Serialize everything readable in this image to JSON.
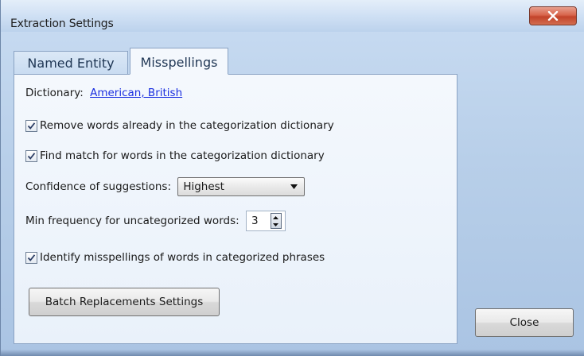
{
  "window": {
    "title": "Extraction Settings"
  },
  "tabs": [
    {
      "label": "Named Entity",
      "active": false
    },
    {
      "label": "Misspellings",
      "active": true
    }
  ],
  "misspellings": {
    "dictionary_label": "Dictionary:",
    "dictionary_value": "American, British",
    "remove_words": {
      "label": "Remove words already in the categorization dictionary",
      "checked": true
    },
    "find_match": {
      "label": "Find match for words in the categorization dictionary",
      "checked": true
    },
    "confidence": {
      "label": "Confidence of suggestions:",
      "value": "Highest"
    },
    "min_frequency": {
      "label": "Min frequency for uncategorized words:",
      "value": "3"
    },
    "identify_misspellings": {
      "label": "Identify misspellings of words in categorized phrases",
      "checked": true
    },
    "batch_button_label": "Batch Replacements Settings"
  },
  "footer": {
    "close_label": "Close"
  },
  "icons": {
    "title_close": "close-icon",
    "checkbox_mark": "checkmark-icon",
    "dropdown": "chevron-down-icon",
    "spin": "spin-arrows-icon"
  },
  "colors": {
    "link": "#1b2fe0",
    "close_button": "#c8472d",
    "window_frame": "#b8cfe9"
  }
}
